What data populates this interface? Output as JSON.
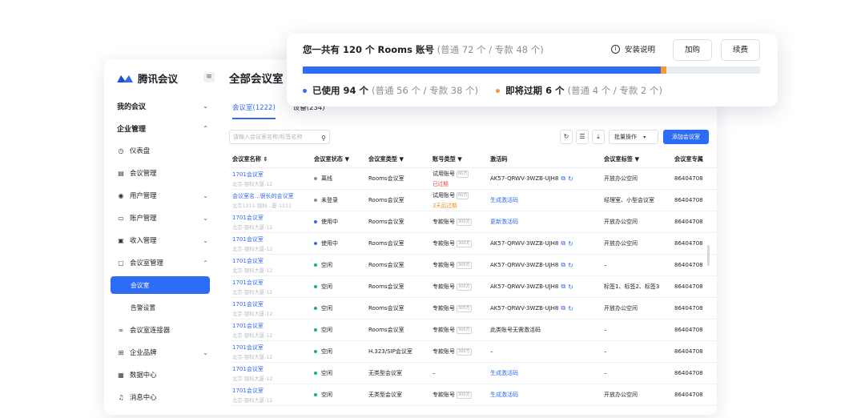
{
  "summary": {
    "title_main": "您一共有 120 个 Rooms 账号",
    "title_detail": "(普通 72 个 / 专款 48 个)",
    "help_label": "安装说明",
    "buy_label": "加购",
    "renew_label": "续费",
    "total": 120,
    "used": 94,
    "expiring": 6,
    "used_text": "已使用 94 个",
    "used_detail": "(普通 56 个 / 专款 38 个)",
    "expiring_text": "即将过期 6 个",
    "expiring_detail": "(普通 4 个 / 专款 2 个)",
    "colors": {
      "used": "#2e6cf6",
      "expiring": "#f29b31",
      "track": "#e9ecf1"
    }
  },
  "brand": {
    "name": "腾讯会议",
    "logo_icon": "tencent-meeting-logo"
  },
  "sidebar": {
    "items": [
      {
        "label": "我的会议",
        "type": "group",
        "chevron": "⌄"
      },
      {
        "label": "企业管理",
        "type": "group",
        "chevron": "⌃"
      },
      {
        "label": "仪表盘",
        "icon": "dashboard-icon",
        "glyph": "◷"
      },
      {
        "label": "会议管理",
        "icon": "meeting-list-icon",
        "glyph": "▤"
      },
      {
        "label": "用户管理",
        "icon": "user-icon",
        "glyph": "◉",
        "chevron": "⌄"
      },
      {
        "label": "账户管理",
        "icon": "account-icon",
        "glyph": "▭",
        "chevron": "⌄"
      },
      {
        "label": "收入管理",
        "icon": "income-icon",
        "glyph": "▣",
        "chevron": "⌄"
      },
      {
        "label": "会议室管理",
        "icon": "meeting-room-icon",
        "glyph": "▢",
        "chevron": "⌃"
      },
      {
        "label": "会议室",
        "type": "active"
      },
      {
        "label": "告警设置",
        "type": "sub"
      },
      {
        "label": "会议室连接器",
        "icon": "connector-icon",
        "glyph": "∞"
      },
      {
        "label": "企业品牌",
        "icon": "brand-icon",
        "glyph": "⊞",
        "chevron": "⌄"
      },
      {
        "label": "数据中心",
        "icon": "data-icon",
        "glyph": "▦"
      },
      {
        "label": "消息中心",
        "icon": "bell-icon",
        "glyph": "♫"
      }
    ]
  },
  "main": {
    "title": "全部会议室",
    "tabs": [
      {
        "label": "会议室(1222)"
      },
      {
        "label": "设备(234)"
      }
    ],
    "search_placeholder": "请输入会议室名称/标签名称",
    "batch_label": "批量操作",
    "add_label": "添加会议室",
    "columns": [
      "会议室名称 ⇕",
      "会议室状态 ▼",
      "会议室类型 ▼",
      "账号类型 ▼",
      "激活码",
      "会议室标签 ▼",
      "会议室专属"
    ],
    "rows": [
      {
        "name": "1701会议室",
        "location": "北京-银科大厦-12",
        "status": "离线",
        "status_color": "#8c9199",
        "type": "Rooms会议室",
        "account": "试用账号",
        "tag": "60方",
        "account_note": "已过期",
        "note_class": "warn-red",
        "code": "AK57-QRWV-3WZB-UJH8",
        "code_kind": "code",
        "label": "开放办公空间",
        "id": "86404708"
      },
      {
        "name": "会议室名...很长的会议室",
        "location": "北京1211-银科...厦-1211",
        "status": "未登录",
        "status_color": "#8c9199",
        "type": "Rooms会议室",
        "account": "试用账号",
        "tag": "60方",
        "account_note": "3天后过期",
        "note_class": "warn-orange",
        "code": "生成激活码",
        "code_kind": "link",
        "label": "经理室、小型会议室",
        "id": "86404708"
      },
      {
        "name": "1701会议室",
        "location": "北京-银科大厦-12",
        "status": "使用中",
        "status_color": "#2e6cf6",
        "type": "Rooms会议室",
        "account": "专款账号",
        "tag": "300方",
        "account_note": "",
        "note_class": "",
        "code": "更新激活码",
        "code_kind": "link",
        "label": "开放办公空间",
        "id": "86404708"
      },
      {
        "name": "1701会议室",
        "location": "北京-银科大厦-12",
        "status": "使用中",
        "status_color": "#2e6cf6",
        "type": "Rooms会议室",
        "account": "专款账号",
        "tag": "300方",
        "account_note": "",
        "note_class": "",
        "code": "AK57-QRWV-3WZB-UJH8",
        "code_kind": "code",
        "label": "开放办公空间",
        "id": "86404708"
      },
      {
        "name": "1701会议室",
        "location": "北京-银科大厦-12",
        "status": "空闲",
        "status_color": "#1fb36b",
        "type": "Rooms会议室",
        "account": "专款账号",
        "tag": "300方",
        "account_note": "",
        "note_class": "",
        "code": "AK57-QRWV-3WZB-UJH8",
        "code_kind": "code",
        "label": "–",
        "id": "86404708"
      },
      {
        "name": "1701会议室",
        "location": "北京-银科大厦-12",
        "status": "空闲",
        "status_color": "#1fb36b",
        "type": "Rooms会议室",
        "account": "专款账号",
        "tag": "300方",
        "account_note": "",
        "note_class": "",
        "code": "AK57-QRWV-3WZB-UJH8",
        "code_kind": "code",
        "label": "标签1、标签2、标签3",
        "id": "86404708"
      },
      {
        "name": "1701会议室",
        "location": "北京-银科大厦-12",
        "status": "空闲",
        "status_color": "#1fb36b",
        "type": "Rooms会议室",
        "account": "专款账号",
        "tag": "300方",
        "account_note": "",
        "note_class": "",
        "code": "AK57-QRWV-3WZB-UJH8",
        "code_kind": "code",
        "label": "开放办公空间",
        "id": "86404708"
      },
      {
        "name": "1701会议室",
        "location": "北京-银科大厦-12",
        "status": "空闲",
        "status_color": "#1fb36b",
        "type": "Rooms会议室",
        "account": "专款账号",
        "tag": "300方",
        "account_note": "",
        "note_class": "",
        "code": "此类账号无需激活码",
        "code_kind": "text",
        "label": "–",
        "id": "86404708"
      },
      {
        "name": "1701会议室",
        "location": "北京-银科大厦-12",
        "status": "空闲",
        "status_color": "#1fb36b",
        "type": "H.323/SIP会议室",
        "account": "专款账号",
        "tag": "300方",
        "account_note": "",
        "note_class": "",
        "code": "–",
        "code_kind": "text",
        "label": "–",
        "id": "86404708"
      },
      {
        "name": "1701会议室",
        "location": "北京-银科大厦-12",
        "status": "空闲",
        "status_color": "#1fb36b",
        "type": "无类型会议室",
        "account": "–",
        "tag": "",
        "account_note": "",
        "note_class": "",
        "code": "生成激活码",
        "code_kind": "link",
        "label": "–",
        "id": "86404708"
      },
      {
        "name": "1701会议室",
        "location": "北京-银科大厦-12",
        "status": "空闲",
        "status_color": "#1fb36b",
        "type": "无类型会议室",
        "account": "专款账号",
        "tag": "300方",
        "account_note": "",
        "note_class": "",
        "code": "生成激活码",
        "code_kind": "link",
        "label": "开放办公空间",
        "id": "86404708"
      }
    ]
  }
}
